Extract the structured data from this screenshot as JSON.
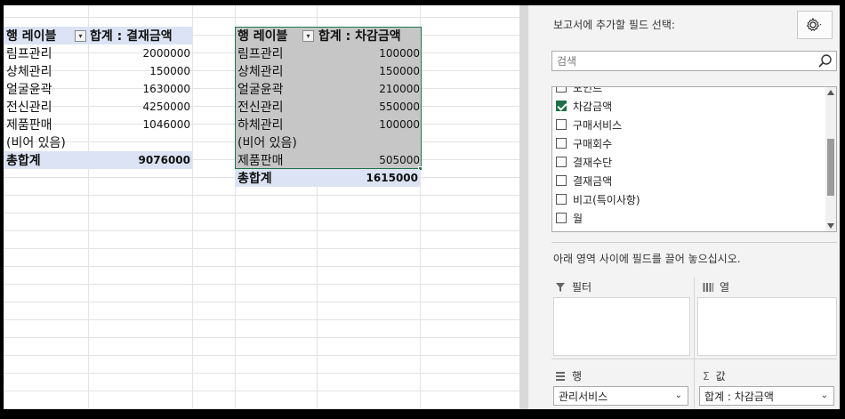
{
  "pivot1": {
    "row_header": "행 레이블",
    "value_header": "합계 : 결재금액",
    "rows": [
      {
        "label": "림프관리",
        "value": "2000000"
      },
      {
        "label": "상체관리",
        "value": "150000"
      },
      {
        "label": "얼굴윤곽",
        "value": "1630000"
      },
      {
        "label": "전신관리",
        "value": "4250000"
      },
      {
        "label": "제품판매",
        "value": "1046000"
      },
      {
        "label": "(비어 있음)",
        "value": ""
      }
    ],
    "total_label": "총합계",
    "total_value": "9076000"
  },
  "pivot2": {
    "row_header": "행 레이블",
    "value_header": "합계 : 차감금액",
    "rows": [
      {
        "label": "림프관리",
        "value": "100000"
      },
      {
        "label": "상체관리",
        "value": "150000"
      },
      {
        "label": "얼굴윤곽",
        "value": "210000"
      },
      {
        "label": "전신관리",
        "value": "550000"
      },
      {
        "label": "하체관리",
        "value": "100000"
      },
      {
        "label": "(비어 있음)",
        "value": ""
      },
      {
        "label": "제품판매",
        "value": "505000"
      }
    ],
    "total_label": "총합계",
    "total_value": "1615000"
  },
  "panel": {
    "title": "보고서에 추가할 필드 선택:",
    "search_placeholder": "검색",
    "fields": [
      {
        "label": "포인트",
        "checked": false
      },
      {
        "label": "차감금액",
        "checked": true
      },
      {
        "label": "구매서비스",
        "checked": false
      },
      {
        "label": "구매회수",
        "checked": false
      },
      {
        "label": "결재수단",
        "checked": false
      },
      {
        "label": "결재금액",
        "checked": false
      },
      {
        "label": "비고(특이사항)",
        "checked": false
      },
      {
        "label": "월",
        "checked": false
      }
    ],
    "drag_hint": "아래 영역 사이에 필드를 끌어 놓으십시오.",
    "filter_label": "필터",
    "columns_label": "열",
    "rows_label": "행",
    "values_label": "값",
    "rows_value": "관리서비스",
    "values_value": "합계 : 차감금액",
    "icons": {
      "settings": "gear-icon",
      "search": "search-icon",
      "filter": "filter-icon",
      "columns": "columns-icon",
      "rows": "rows-icon",
      "values": "sigma-icon"
    }
  },
  "colors": {
    "pivot_header": "#dbe3f4",
    "selection": "#c6c6c6",
    "excel_green": "#217346"
  }
}
